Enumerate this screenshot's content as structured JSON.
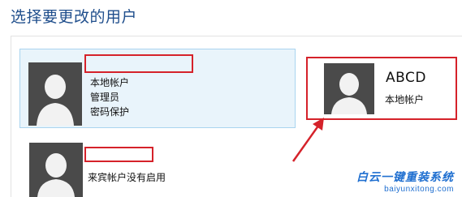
{
  "header": {
    "title": "选择要更改的用户"
  },
  "users": [
    {
      "lines": [
        "本地帐户",
        "管理员",
        "密码保护"
      ]
    },
    {
      "name": "ABCD",
      "sub": "本地帐户"
    },
    {
      "line": "来宾帐户没有启用"
    }
  ],
  "watermark": {
    "logo": "白云一键重装系统",
    "url": "baiyunxitong.com"
  },
  "colors": {
    "accent": "#1f4e8c",
    "selection": "#e9f4fb",
    "highlight": "#d5222a",
    "avatar": "#4a4a4a"
  }
}
